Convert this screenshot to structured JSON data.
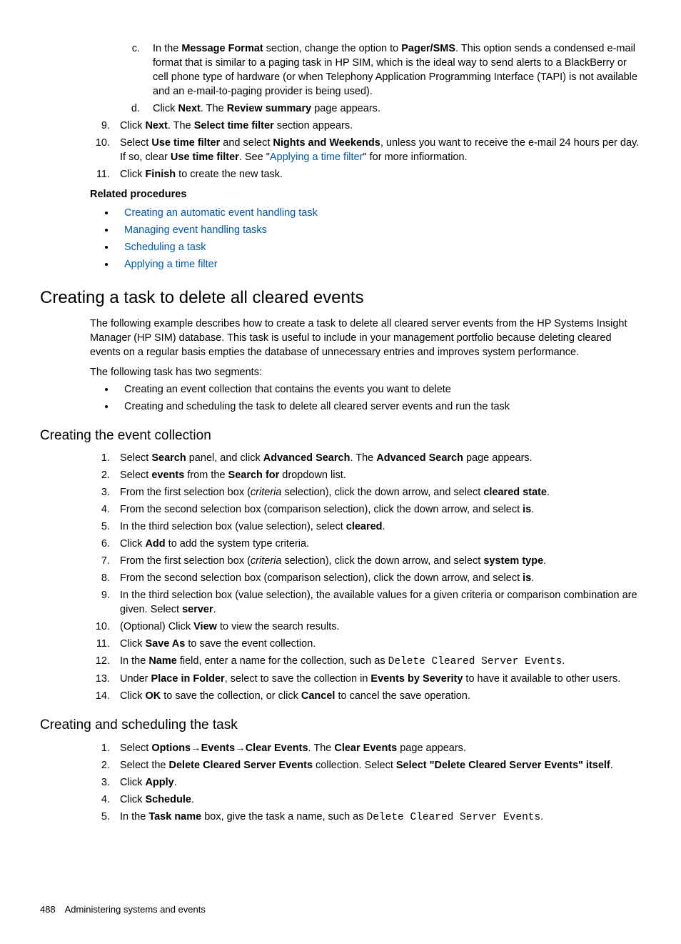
{
  "top": {
    "alpha_start": 3,
    "alpha": [
      {
        "pre": "In the ",
        "b1": "Message Format",
        "mid1": " section, change the option to ",
        "b2": "Pager/SMS",
        "post": ". This option sends a condensed e-mail format that is similar to a paging task in HP SIM, which is the ideal way to send alerts to a BlackBerry or cell phone type of hardware (or when Telephony Application Programming Interface (TAPI) is not available and an e-mail-to-paging provider is being used)."
      },
      {
        "pre": "Click ",
        "b1": "Next",
        "mid1": ". The ",
        "b2": "Review summary",
        "post": " page appears."
      }
    ],
    "numeric_start": 9,
    "numeric": [
      {
        "parts": [
          {
            "t": "Click ",
            "b": false
          },
          {
            "t": "Next",
            "b": true
          },
          {
            "t": ". The ",
            "b": false
          },
          {
            "t": "Select time filter",
            "b": true
          },
          {
            "t": " section appears.",
            "b": false
          }
        ]
      },
      {
        "parts": [
          {
            "t": "Select ",
            "b": false
          },
          {
            "t": "Use time filter",
            "b": true
          },
          {
            "t": " and select ",
            "b": false
          },
          {
            "t": "Nights and Weekends",
            "b": true
          },
          {
            "t": ", unless you want to receive the e-mail 24 hours per day. If so, clear ",
            "b": false
          },
          {
            "t": "Use time filter",
            "b": true
          },
          {
            "t": ". See \"",
            "b": false
          },
          {
            "t": "Applying a time filter",
            "link": true
          },
          {
            "t": "\" for more infiormation.",
            "b": false
          }
        ]
      },
      {
        "parts": [
          {
            "t": "Click ",
            "b": false
          },
          {
            "t": "Finish",
            "b": true
          },
          {
            "t": " to create the new task.",
            "b": false
          }
        ]
      }
    ],
    "related_heading": "Related procedures",
    "related": [
      "Creating an automatic event handling task",
      "Managing event handling tasks",
      "Scheduling a task",
      "Applying a time filter"
    ]
  },
  "section2": {
    "heading": "Creating a task to delete all cleared events",
    "para1": "The following example describes how to create a task to delete all cleared server events from the HP Systems Insight Manager (HP SIM) database. This task is useful to include in your management portfolio because deleting cleared events on a regular basis empties the database of unnecessary entries and improves system performance.",
    "para2": "The following task has two segments:",
    "segments": [
      "Creating an event collection that contains the events you want to delete",
      "Creating and scheduling the task to delete all cleared server events and run the task"
    ]
  },
  "section3": {
    "heading": "Creating the event collection",
    "steps": [
      [
        {
          "t": "Select "
        },
        {
          "t": "Search",
          "b": true
        },
        {
          "t": " panel, and click "
        },
        {
          "t": "Advanced Search",
          "b": true
        },
        {
          "t": ". The "
        },
        {
          "t": "Advanced Search",
          "b": true
        },
        {
          "t": " page appears."
        }
      ],
      [
        {
          "t": "Select "
        },
        {
          "t": "events",
          "b": true
        },
        {
          "t": " from the "
        },
        {
          "t": "Search for",
          "b": true
        },
        {
          "t": " dropdown list."
        }
      ],
      [
        {
          "t": "From the first selection box ("
        },
        {
          "t": "criteria",
          "i": true
        },
        {
          "t": " selection), click the down arrow, and select "
        },
        {
          "t": "cleared state",
          "b": true
        },
        {
          "t": "."
        }
      ],
      [
        {
          "t": "From the second selection box (comparison selection), click the down arrow, and select "
        },
        {
          "t": "is",
          "b": true
        },
        {
          "t": "."
        }
      ],
      [
        {
          "t": "In the third selection box (value selection), select "
        },
        {
          "t": "cleared",
          "b": true
        },
        {
          "t": "."
        }
      ],
      [
        {
          "t": "Click "
        },
        {
          "t": "Add",
          "b": true
        },
        {
          "t": " to add the system type criteria."
        }
      ],
      [
        {
          "t": "From the first selection box ("
        },
        {
          "t": "criteria",
          "i": true
        },
        {
          "t": " selection), click the down arrow, and select "
        },
        {
          "t": "system type",
          "b": true
        },
        {
          "t": "."
        }
      ],
      [
        {
          "t": "From the second selection box (comparison selection), click the down arrow, and select "
        },
        {
          "t": "is",
          "b": true
        },
        {
          "t": "."
        }
      ],
      [
        {
          "t": "In the third selection box (value selection), the available values for a given criteria or comparison combination are given. Select "
        },
        {
          "t": "server",
          "b": true
        },
        {
          "t": "."
        }
      ],
      [
        {
          "t": "(Optional) Click "
        },
        {
          "t": "View",
          "b": true
        },
        {
          "t": " to view the search results."
        }
      ],
      [
        {
          "t": "Click "
        },
        {
          "t": "Save As",
          "b": true
        },
        {
          "t": " to save the event collection."
        }
      ],
      [
        {
          "t": "In the "
        },
        {
          "t": "Name",
          "b": true
        },
        {
          "t": " field, enter a name for the collection, such as "
        },
        {
          "t": "Delete Cleared Server Events",
          "mono": true
        },
        {
          "t": "."
        }
      ],
      [
        {
          "t": "Under "
        },
        {
          "t": "Place in Folder",
          "b": true
        },
        {
          "t": ", select to save the collection in "
        },
        {
          "t": "Events by Severity",
          "b": true
        },
        {
          "t": " to have it available to other users."
        }
      ],
      [
        {
          "t": "Click "
        },
        {
          "t": "OK",
          "b": true
        },
        {
          "t": " to save the collection, or click "
        },
        {
          "t": "Cancel",
          "b": true
        },
        {
          "t": " to cancel the save operation."
        }
      ]
    ]
  },
  "section4": {
    "heading": "Creating and scheduling the task",
    "steps": [
      [
        {
          "t": "Select "
        },
        {
          "t": "Options",
          "b": true
        },
        {
          "t": "→",
          "arrow": true
        },
        {
          "t": "Events",
          "b": true
        },
        {
          "t": "→",
          "arrow": true
        },
        {
          "t": "Clear Events",
          "b": true
        },
        {
          "t": ". The "
        },
        {
          "t": "Clear Events",
          "b": true
        },
        {
          "t": " page appears."
        }
      ],
      [
        {
          "t": "Select the "
        },
        {
          "t": "Delete Cleared Server Events",
          "b": true
        },
        {
          "t": " collection. Select "
        },
        {
          "t": "Select \"Delete Cleared Server Events\" itself",
          "b": true
        },
        {
          "t": "."
        }
      ],
      [
        {
          "t": "Click "
        },
        {
          "t": "Apply",
          "b": true
        },
        {
          "t": "."
        }
      ],
      [
        {
          "t": "Click "
        },
        {
          "t": "Schedule",
          "b": true
        },
        {
          "t": "."
        }
      ],
      [
        {
          "t": "In the "
        },
        {
          "t": "Task name",
          "b": true
        },
        {
          "t": " box, give the task a name, such as "
        },
        {
          "t": "Delete Cleared Server Events",
          "mono": true
        },
        {
          "t": "."
        }
      ]
    ]
  },
  "footer": {
    "page": "488",
    "title": "Administering systems and events"
  }
}
